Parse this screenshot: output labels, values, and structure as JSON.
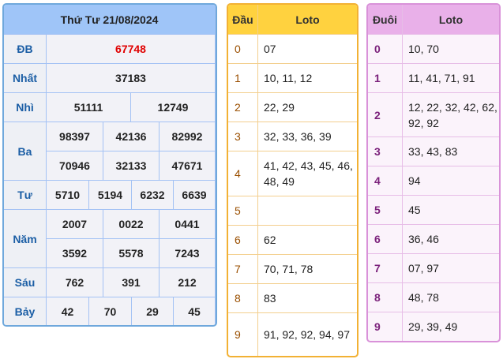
{
  "results": {
    "title": "Thứ Tư 21/08/2024",
    "prizes": [
      {
        "label": "ĐB",
        "numbers": [
          "67748"
        ]
      },
      {
        "label": "Nhất",
        "numbers": [
          "37183"
        ]
      },
      {
        "label": "Nhì",
        "numbers": [
          "51111",
          "12749"
        ]
      },
      {
        "label": "Ba",
        "numbers": [
          "98397",
          "42136",
          "82992",
          "70946",
          "32133",
          "47671"
        ]
      },
      {
        "label": "Tư",
        "numbers": [
          "5710",
          "5194",
          "6232",
          "6639"
        ]
      },
      {
        "label": "Năm",
        "numbers": [
          "2007",
          "0022",
          "0441",
          "3592",
          "5578",
          "7243"
        ]
      },
      {
        "label": "Sáu",
        "numbers": [
          "762",
          "391",
          "212"
        ]
      },
      {
        "label": "Bảy",
        "numbers": [
          "42",
          "70",
          "29",
          "45"
        ]
      }
    ]
  },
  "dau": {
    "head_label": "Đầu",
    "loto_label": "Loto",
    "rows": [
      {
        "digit": "0",
        "loto": "07"
      },
      {
        "digit": "1",
        "loto": "10, 11, 12"
      },
      {
        "digit": "2",
        "loto": "22, 29"
      },
      {
        "digit": "3",
        "loto": "32, 33, 36, 39"
      },
      {
        "digit": "4",
        "loto": "41, 42, 43, 45, 46, 48, 49"
      },
      {
        "digit": "5",
        "loto": ""
      },
      {
        "digit": "6",
        "loto": "62"
      },
      {
        "digit": "7",
        "loto": "70, 71, 78"
      },
      {
        "digit": "8",
        "loto": "83"
      },
      {
        "digit": "9",
        "loto": "91, 92, 92, 94, 97"
      }
    ]
  },
  "duoi": {
    "head_label": "Đuôi",
    "loto_label": "Loto",
    "rows": [
      {
        "digit": "0",
        "loto": "10, 70"
      },
      {
        "digit": "1",
        "loto": "11, 41, 71, 91"
      },
      {
        "digit": "2",
        "loto": "12, 22, 32, 42, 62, 92, 92"
      },
      {
        "digit": "3",
        "loto": "33, 43, 83"
      },
      {
        "digit": "4",
        "loto": "94"
      },
      {
        "digit": "5",
        "loto": "45"
      },
      {
        "digit": "6",
        "loto": "36, 46"
      },
      {
        "digit": "7",
        "loto": "07, 97"
      },
      {
        "digit": "8",
        "loto": "48, 78"
      },
      {
        "digit": "9",
        "loto": "29, 39, 49"
      }
    ]
  }
}
